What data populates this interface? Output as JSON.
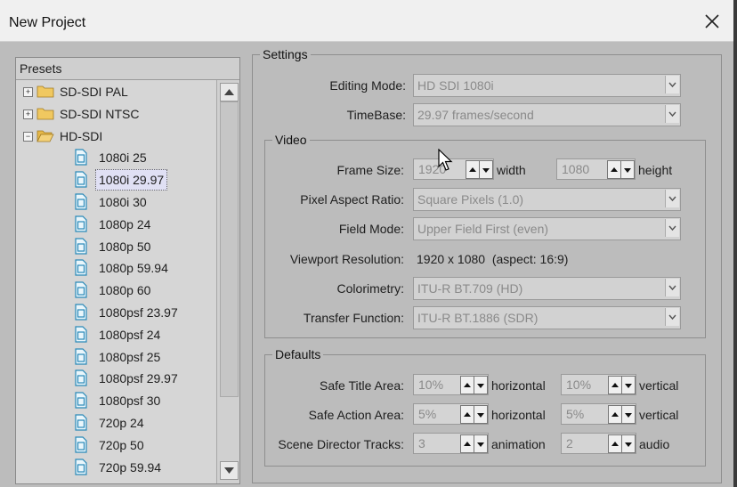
{
  "window": {
    "title": "New Project"
  },
  "presets": {
    "header": "Presets",
    "items": [
      {
        "label": "SD-SDI PAL",
        "type": "folder",
        "expander": "+"
      },
      {
        "label": "SD-SDI NTSC",
        "type": "folder",
        "expander": "+"
      },
      {
        "label": "HD-SDI",
        "type": "folder-open",
        "expander": "−"
      },
      {
        "label": "1080i 25",
        "type": "file"
      },
      {
        "label": "1080i 29.97",
        "type": "file",
        "selected": true
      },
      {
        "label": "1080i 30",
        "type": "file"
      },
      {
        "label": "1080p 24",
        "type": "file"
      },
      {
        "label": "1080p 50",
        "type": "file"
      },
      {
        "label": "1080p 59.94",
        "type": "file"
      },
      {
        "label": "1080p 60",
        "type": "file"
      },
      {
        "label": "1080psf 23.97",
        "type": "file"
      },
      {
        "label": "1080psf 24",
        "type": "file"
      },
      {
        "label": "1080psf 25",
        "type": "file"
      },
      {
        "label": "1080psf 29.97",
        "type": "file"
      },
      {
        "label": "1080psf 30",
        "type": "file"
      },
      {
        "label": "720p 24",
        "type": "file"
      },
      {
        "label": "720p 50",
        "type": "file"
      },
      {
        "label": "720p 59.94",
        "type": "file"
      }
    ]
  },
  "settings": {
    "legend": "Settings",
    "editing_mode": {
      "label": "Editing Mode:",
      "value": "HD SDI 1080i"
    },
    "timebase": {
      "label": "TimeBase:",
      "value": "29.97 frames/second"
    },
    "video": {
      "legend": "Video",
      "frame_size": {
        "label": "Frame Size:",
        "width_value": "1920",
        "width_unit": "width",
        "height_value": "1080",
        "height_unit": "height"
      },
      "pixel_aspect": {
        "label": "Pixel Aspect Ratio:",
        "value": "Square Pixels (1.0)"
      },
      "field_mode": {
        "label": "Field Mode:",
        "value": "Upper Field First (even)"
      },
      "viewport": {
        "label": "Viewport Resolution:",
        "value": "1920 x 1080  (aspect: 16:9)"
      },
      "colorimetry": {
        "label": "Colorimetry:",
        "value": "ITU-R BT.709 (HD)"
      },
      "transfer": {
        "label": "Transfer Function:",
        "value": "ITU-R BT.1886 (SDR)"
      }
    },
    "defaults": {
      "legend": "Defaults",
      "safe_title": {
        "label": "Safe Title Area:",
        "h_value": "10%",
        "h_unit": "horizontal",
        "v_value": "10%",
        "v_unit": "vertical"
      },
      "safe_action": {
        "label": "Safe Action Area:",
        "h_value": "5%",
        "h_unit": "horizontal",
        "v_value": "5%",
        "v_unit": "vertical"
      },
      "scene_tracks": {
        "label": "Scene Director Tracks:",
        "a_value": "3",
        "a_unit": "animation",
        "b_value": "2",
        "b_unit": "audio"
      }
    }
  }
}
